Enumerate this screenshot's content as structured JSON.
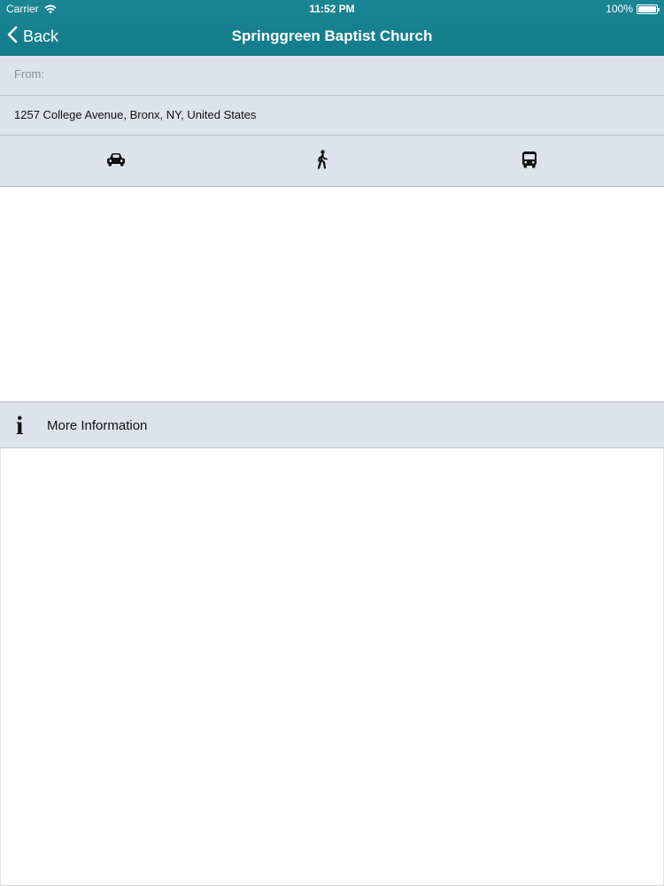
{
  "status": {
    "carrier": "Carrier",
    "time": "11:52 PM",
    "battery": "100%"
  },
  "nav": {
    "back_label": "Back",
    "title": "Springgreen Baptist Church"
  },
  "directions": {
    "from_label": "From:",
    "address": "1257 College Avenue, Bronx, NY, United States",
    "modes": [
      "car-icon",
      "walk-icon",
      "bus-icon"
    ]
  },
  "info": {
    "label": "More Information",
    "icon": "i"
  },
  "colors": {
    "header": "#158290",
    "row_bg": "#dde3e8"
  }
}
